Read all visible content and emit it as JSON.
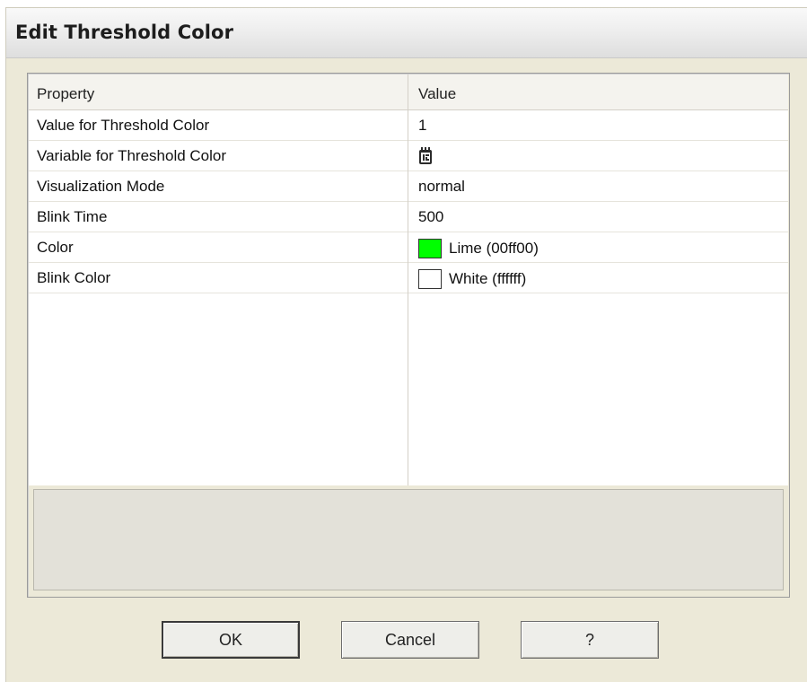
{
  "window": {
    "title": "Edit Threshold Color"
  },
  "grid": {
    "headers": {
      "property": "Property",
      "value": "Value"
    },
    "rows": [
      {
        "property": "Value for Threshold Color",
        "value": "1"
      },
      {
        "property": "Variable for Threshold Color",
        "value": "",
        "icon": "variable-tag-icon"
      },
      {
        "property": "Visualization Mode",
        "value": "normal"
      },
      {
        "property": "Blink Time",
        "value": "500"
      },
      {
        "property": "Color",
        "value": "Lime (00ff00)",
        "swatch": "#00ff00"
      },
      {
        "property": "Blink Color",
        "value": "White (ffffff)",
        "swatch": "#ffffff"
      }
    ]
  },
  "buttons": {
    "ok": "OK",
    "cancel": "Cancel",
    "help": "?"
  }
}
